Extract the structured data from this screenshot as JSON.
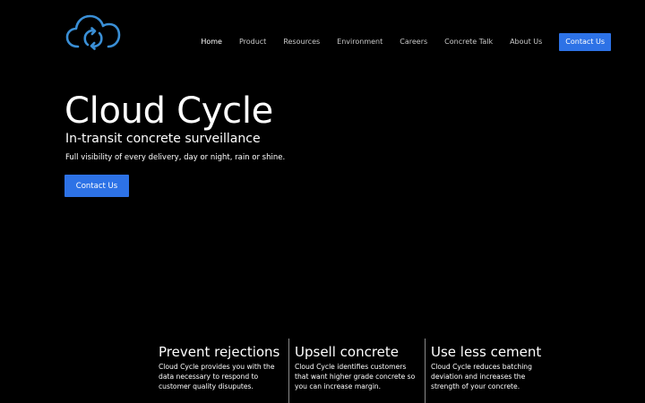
{
  "brand": {
    "logo_icon": "cloud-cycle-icon",
    "accent": "#2d72e6",
    "logo_color": "#3a8fd6"
  },
  "nav": {
    "items": [
      {
        "label": "Home",
        "active": true
      },
      {
        "label": "Product"
      },
      {
        "label": "Resources"
      },
      {
        "label": "Environment"
      },
      {
        "label": "Careers"
      },
      {
        "label": "Concrete Talk"
      },
      {
        "label": "About Us"
      }
    ],
    "cta_label": "Contact Us"
  },
  "hero": {
    "title": "Cloud Cycle",
    "subtitle": "In-transit concrete surveillance",
    "description": "Full visibility of every delivery, day or night, rain or shine.",
    "cta_label": "Contact Us"
  },
  "features": [
    {
      "title": "Prevent rejections",
      "text": "Cloud Cycle provides you with the data necessary to respond to customer quality disuputes."
    },
    {
      "title": "Upsell concrete",
      "text": "Cloud Cycle identifies customers that want higher grade concrete so you can increase margin."
    },
    {
      "title": "Use less cement",
      "text": "Cloud Cycle reduces batching deviation and increases the strength of your concrete."
    }
  ]
}
